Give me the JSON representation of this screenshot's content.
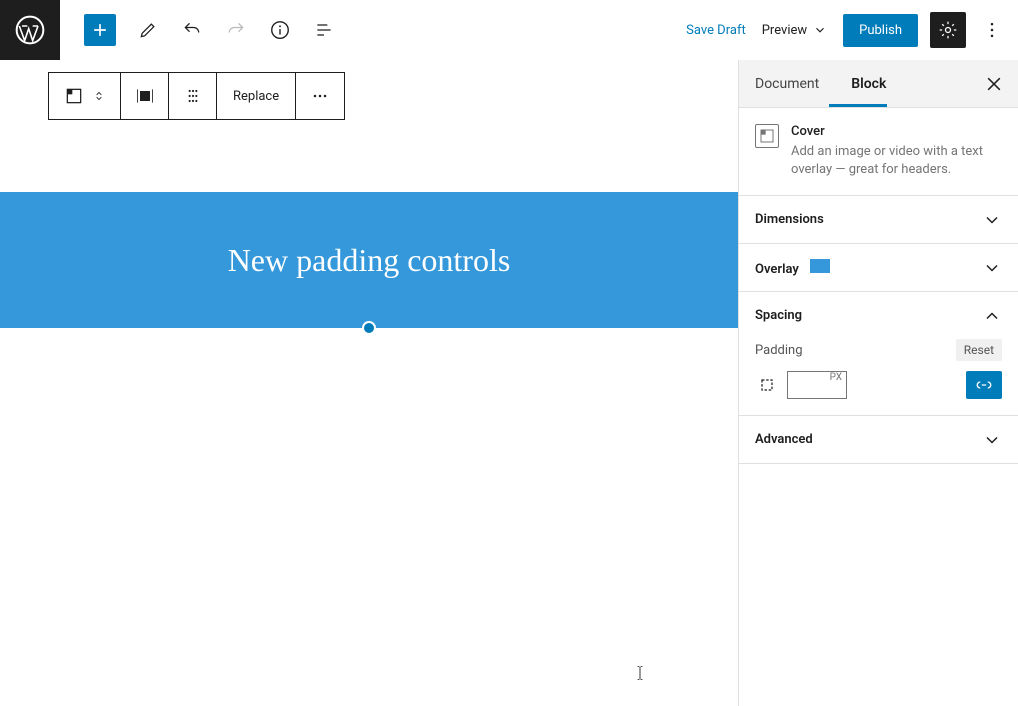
{
  "topbar": {
    "save_draft": "Save Draft",
    "preview": "Preview",
    "publish": "Publish"
  },
  "block_toolbar": {
    "replace": "Replace"
  },
  "cover": {
    "title": "New padding controls",
    "bg_color": "#3498db"
  },
  "sidebar": {
    "tabs": {
      "document": "Document",
      "block": "Block",
      "active": "block"
    },
    "block_info": {
      "name": "Cover",
      "description": "Add an image or video with a text overlay — great for headers."
    },
    "panels": {
      "dimensions": {
        "title": "Dimensions",
        "open": false
      },
      "overlay": {
        "title": "Overlay",
        "open": false,
        "color": "#3498db"
      },
      "spacing": {
        "title": "Spacing",
        "open": true,
        "padding_label": "Padding",
        "reset": "Reset",
        "unit": "PX",
        "value": ""
      },
      "advanced": {
        "title": "Advanced",
        "open": false
      }
    }
  },
  "colors": {
    "primary": "#007cba",
    "cover": "#3498db"
  }
}
